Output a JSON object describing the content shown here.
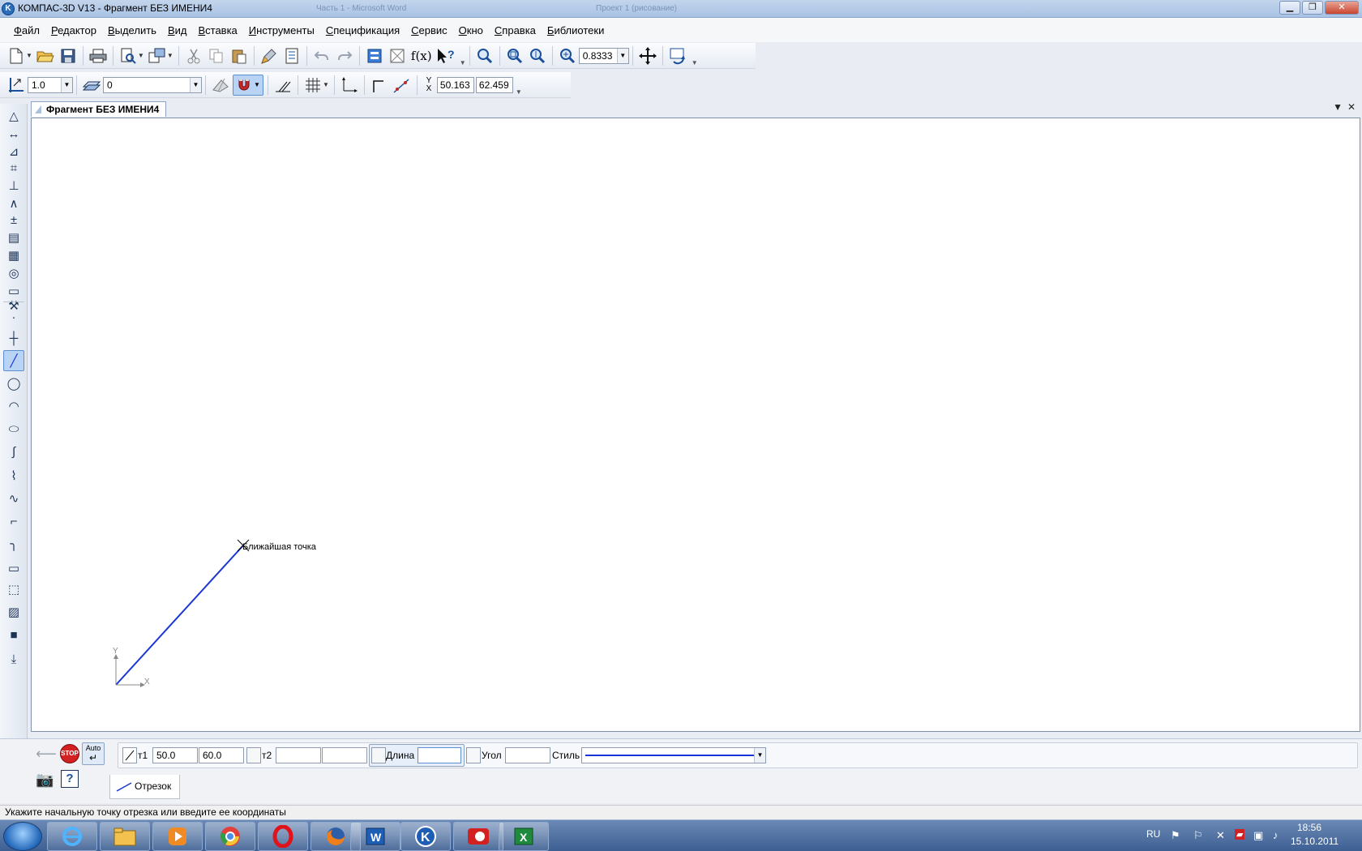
{
  "window": {
    "title": "КОМПАС-3D V13 - Фрагмент БЕЗ ИМЕНИ4",
    "app_icon_letter": "K",
    "background_window_titles": [
      "Часть 1 - Microsoft Word",
      "Проект 1 (рисование)"
    ],
    "buttons": {
      "minimize": "▁",
      "maximize": "❐",
      "close": "✕"
    }
  },
  "menu": [
    "Файл",
    "Редактор",
    "Выделить",
    "Вид",
    "Вставка",
    "Инструменты",
    "Спецификация",
    "Сервис",
    "Окно",
    "Справка",
    "Библиотеки"
  ],
  "toolbar1": {
    "zoom_value": "0.8333",
    "function_label": "f(x)",
    "icons": [
      "new-file-icon",
      "open-folder-icon",
      "save-icon",
      "print-icon",
      "preview-icon",
      "manager-icon",
      "cut-icon",
      "copy-icon",
      "paste-icon",
      "brush-icon",
      "properties-icon",
      "undo-icon",
      "redo-icon",
      "library-manager-icon",
      "spec-icon",
      "function-icon",
      "context-help-icon",
      "zoom-window-icon",
      "zoom-in-icon",
      "zoom-out-icon",
      "zoom-level-icon",
      "pan-icon",
      "refresh-icon"
    ]
  },
  "toolbar2": {
    "step_value": "1.0",
    "layer_value": "0",
    "coord_label_y": "Y",
    "coord_label_x": "X",
    "coord_x": "50.163",
    "coord_y": "62.459"
  },
  "document": {
    "tab_title": "Фрагмент БЕЗ ИМЕНИ4",
    "tab_menu": "▼",
    "tab_close": "✕",
    "snap_hint": "Ближайшая точка",
    "axis_x": "X",
    "axis_y": "Y",
    "line_color": "#1a35d6"
  },
  "left_panel_icons": [
    "geometry-icon",
    "dimensions-icon",
    "designations-icon",
    "editing-icon",
    "parametrization-icon",
    "measure-icon",
    "select-icon",
    "associative-views-icon",
    "spec-objects-icon",
    "reports-icon",
    "insert-icon",
    "macro-icon",
    "point-icon",
    "auxiliary-line-icon",
    "segment-icon",
    "circle-icon",
    "arc-icon",
    "ellipse-icon",
    "continuous-line-icon",
    "polyline-icon",
    "spline-icon",
    "chamfer-icon",
    "fillet-icon",
    "rectangle-icon",
    "contour-icon",
    "hatch-icon",
    "fill-icon",
    "collect-contour-icon"
  ],
  "properties": {
    "auto_label": "Auto",
    "stop_label": "STOP",
    "help_label": "?",
    "t1_label": "т1",
    "t1_x": "50.0",
    "t1_y": "60.0",
    "t2_label": "т2",
    "t2_x": "",
    "t2_y": "",
    "length_label": "Длина",
    "length_value": "",
    "angle_label": "Угол",
    "angle_value": "",
    "style_label": "Стиль",
    "tab_label": "Отрезок"
  },
  "status": {
    "text": "Укажите начальную точку отрезка или введите ее координаты"
  },
  "taskbar": {
    "apps": [
      "internet-explorer-icon",
      "explorer-folder-icon",
      "media-player-icon",
      "chrome-icon",
      "opera-icon",
      "firefox-icon",
      "word-icon",
      "kompas-icon",
      "kompas-viewer-icon",
      "excel-icon"
    ],
    "lang": "RU",
    "time": "18:56",
    "date": "15.10.2011"
  }
}
